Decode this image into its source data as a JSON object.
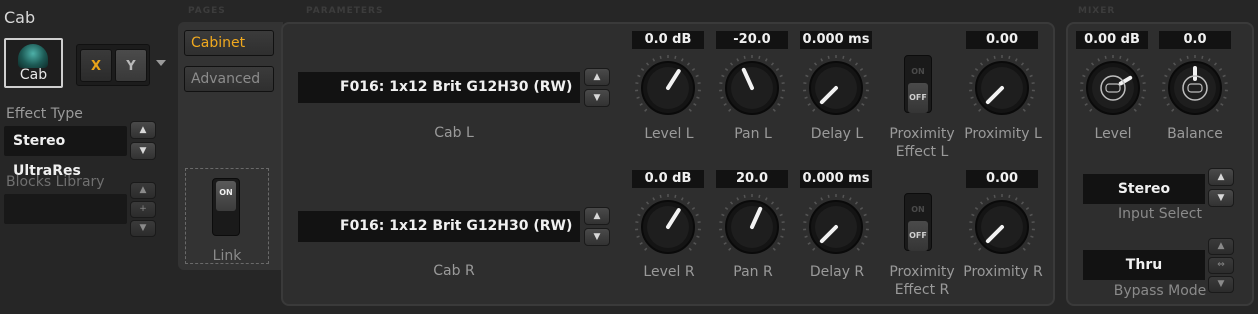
{
  "block": {
    "title": "Cab",
    "icon_label": "Cab",
    "x_label": "X",
    "y_label": "Y",
    "effect_type_label": "Effect Type",
    "effect_type_value": "Stereo UltraRes",
    "blocks_library_label": "Blocks Library",
    "blocks_library_value": ""
  },
  "sections": {
    "pages": "PAGES",
    "parameters": "PARAMETERS",
    "mixer": "MIXER"
  },
  "pages": {
    "cabinet": "Cabinet",
    "advanced": "Advanced",
    "link_label": "Link",
    "link_toggle": "ON",
    "link_state": "on"
  },
  "spin_glyphs": {
    "up": "▲",
    "down": "▼",
    "plus": "+",
    "link": "⇔"
  },
  "params": {
    "cab_l": {
      "value": "F016: 1x12 Brit G12H30 (RW)",
      "label": "Cab L"
    },
    "cab_r": {
      "value": "F016: 1x12 Brit G12H30 (RW)",
      "label": "Cab R"
    },
    "level_l": {
      "display": "0.0 dB",
      "label": "Level L",
      "level": 0.62
    },
    "pan_l": {
      "display": "-20.0",
      "label": "Pan L",
      "level": 0.41
    },
    "delay_l": {
      "display": "0.000 ms",
      "label": "Delay L",
      "level": 0.0
    },
    "prox_effect_l": {
      "label_1": "Proximity",
      "label_2": "Effect L",
      "toggle_on": "ON",
      "toggle_off": "OFF",
      "state": "off"
    },
    "proximity_l": {
      "display": "0.00",
      "label": "Proximity L",
      "level": 0.0
    },
    "level_r": {
      "display": "0.0 dB",
      "label": "Level R",
      "level": 0.62
    },
    "pan_r": {
      "display": "20.0",
      "label": "Pan R",
      "level": 0.59
    },
    "delay_r": {
      "display": "0.000 ms",
      "label": "Delay R",
      "level": 0.0
    },
    "prox_effect_r": {
      "label_1": "Proximity",
      "label_2": "Effect R",
      "toggle_on": "ON",
      "toggle_off": "OFF",
      "state": "off"
    },
    "proximity_r": {
      "display": "0.00",
      "label": "Proximity R",
      "level": 0.0
    }
  },
  "mixer": {
    "level": {
      "display": "0.00 dB",
      "label": "Level",
      "level": 0.72
    },
    "balance": {
      "display": "0.0",
      "label": "Balance",
      "level": 0.5
    },
    "input_select": {
      "value": "Stereo",
      "label": "Input Select"
    },
    "bypass_mode": {
      "value": "Thru",
      "label": "Bypass Mode"
    }
  },
  "colors": {
    "accent": "#f0a91f",
    "x_button": "#e8a319",
    "text": "#9a9a9a",
    "field_bg": "#121212"
  }
}
